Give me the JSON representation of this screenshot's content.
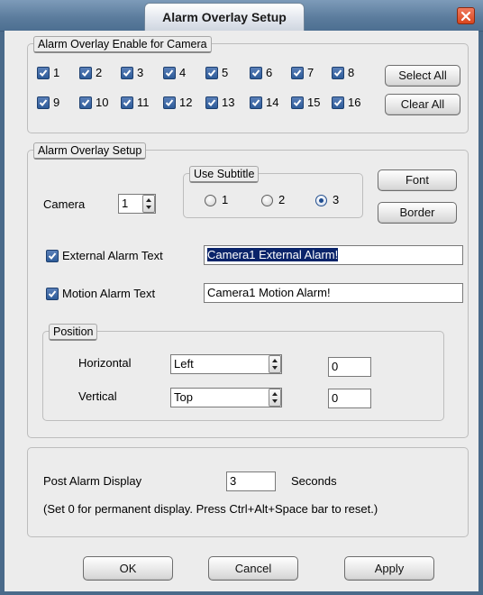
{
  "window": {
    "title": "Alarm Overlay Setup"
  },
  "enable_group": {
    "label": "Alarm Overlay Enable for Camera",
    "cameras": [
      "1",
      "2",
      "3",
      "4",
      "5",
      "6",
      "7",
      "8",
      "9",
      "10",
      "11",
      "12",
      "13",
      "14",
      "15",
      "16"
    ],
    "checked": [
      true,
      true,
      true,
      true,
      true,
      true,
      true,
      true,
      true,
      true,
      true,
      true,
      true,
      true,
      true,
      true
    ],
    "select_all_label": "Select All",
    "clear_all_label": "Clear All"
  },
  "setup_group": {
    "label": "Alarm Overlay Setup",
    "camera_label": "Camera",
    "camera_value": "1",
    "subtitle_label": "Use Subtitle",
    "subtitle_options": [
      "1",
      "2",
      "3"
    ],
    "subtitle_selected": "3",
    "font_button": "Font",
    "border_button": "Border",
    "external_alarm_label": "External Alarm Text",
    "external_alarm_checked": true,
    "external_alarm_value": "Camera1 External Alarm!",
    "motion_alarm_label": "Motion Alarm Text",
    "motion_alarm_checked": true,
    "motion_alarm_value": "Camera1 Motion Alarm!",
    "position": {
      "label": "Position",
      "horizontal_label": "Horizontal",
      "horizontal_value": "Left",
      "horizontal_offset": "0",
      "vertical_label": "Vertical",
      "vertical_value": "Top",
      "vertical_offset": "0"
    }
  },
  "post_alarm": {
    "label": "Post Alarm Display",
    "value": "3",
    "unit": "Seconds",
    "note": "(Set 0 for permanent display.  Press Ctrl+Alt+Space bar to reset.)"
  },
  "footer": {
    "ok_label": "OK",
    "cancel_label": "Cancel",
    "apply_label": "Apply"
  },
  "colors": {
    "title_bar": "#5a7b9c",
    "checkbox_fill": "#2e5c99",
    "close_button": "#d9461e",
    "selection_highlight": "#0a246a"
  }
}
